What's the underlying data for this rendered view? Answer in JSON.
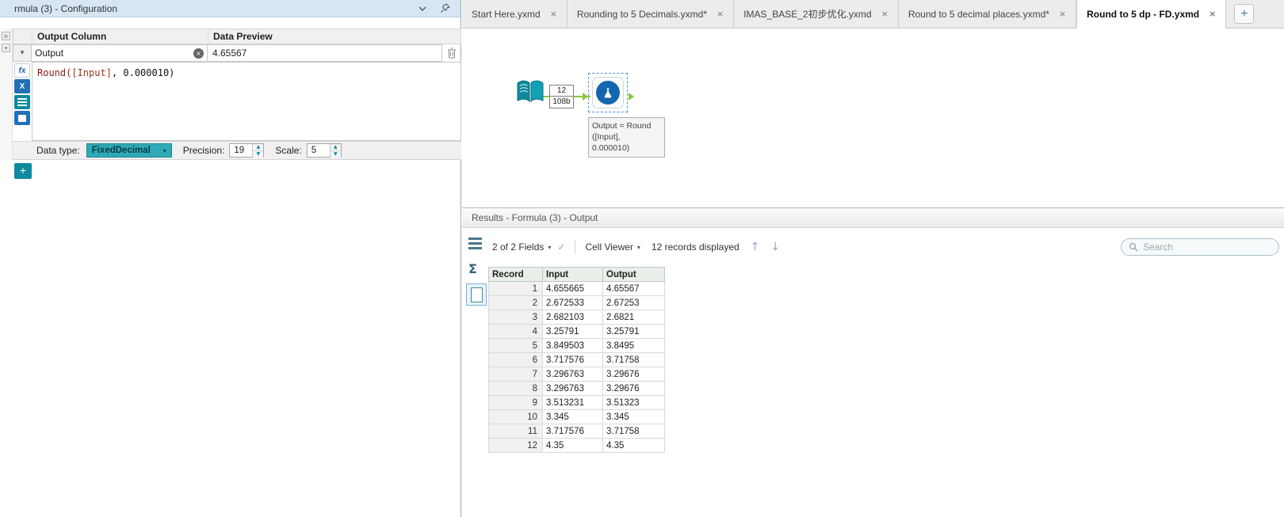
{
  "icons": {
    "close": "×",
    "plus": "+",
    "caret_down": "▾",
    "chevron_down": "▾",
    "check": "✓",
    "arrow_up": "↑",
    "arrow_down": "↓",
    "sigma": "Σ",
    "spin_up": "▲",
    "spin_down": "▼",
    "clear": "×",
    "fx": "fx",
    "x_var": "X",
    "grip": "≡"
  },
  "colors": {
    "accent_teal": "#0e8a9f",
    "tool_blue": "#1566b0",
    "wire_green": "#8cc63f",
    "titlebar_blue": "#d8e6f4"
  },
  "config": {
    "title": "rmula (3) - Configuration",
    "grid": {
      "col1": "Output Column",
      "col2": "Data Preview"
    },
    "row": {
      "name": "Output",
      "preview": "4.65567"
    },
    "expression": {
      "func": "Round(",
      "variable": "[Input]",
      "tail": ", 0.000010)"
    },
    "footer": {
      "data_type_label": "Data type:",
      "data_type_value": "FixedDecimal",
      "precision_label": "Precision:",
      "precision_value": "19",
      "scale_label": "Scale:",
      "scale_value": "5"
    },
    "add_label": "+"
  },
  "tabs": [
    {
      "label": "Start Here.yxmd"
    },
    {
      "label": "Rounding to 5 Decimals.yxmd*"
    },
    {
      "label": "IMAS_BASE_2初步优化.yxmd"
    },
    {
      "label": "Round to 5 decimal places.yxmd*"
    },
    {
      "label": "Round to 5 dp - FD.yxmd"
    }
  ],
  "canvas": {
    "connection": {
      "records": "12",
      "size": "108b"
    },
    "annotation_lines": [
      "Output = Round",
      "([Input],",
      "0.000010)"
    ]
  },
  "results": {
    "title": "Results - Formula (3) - Output",
    "fields_dropdown": "2 of 2 Fields",
    "cell_viewer": "Cell Viewer",
    "records_displayed": "12 records displayed",
    "search_placeholder": "Search",
    "table": {
      "headers": [
        "Record",
        "Input",
        "Output"
      ],
      "rows": [
        [
          "1",
          "4.655665",
          "4.65567"
        ],
        [
          "2",
          "2.672533",
          "2.67253"
        ],
        [
          "3",
          "2.682103",
          "2.6821"
        ],
        [
          "4",
          "3.25791",
          "3.25791"
        ],
        [
          "5",
          "3.849503",
          "3.8495"
        ],
        [
          "6",
          "3.717576",
          "3.71758"
        ],
        [
          "7",
          "3.296763",
          "3.29676"
        ],
        [
          "8",
          "3.296763",
          "3.29676"
        ],
        [
          "9",
          "3.513231",
          "3.51323"
        ],
        [
          "10",
          "3.345",
          "3.345"
        ],
        [
          "11",
          "3.717576",
          "3.71758"
        ],
        [
          "12",
          "4.35",
          "4.35"
        ]
      ]
    }
  }
}
